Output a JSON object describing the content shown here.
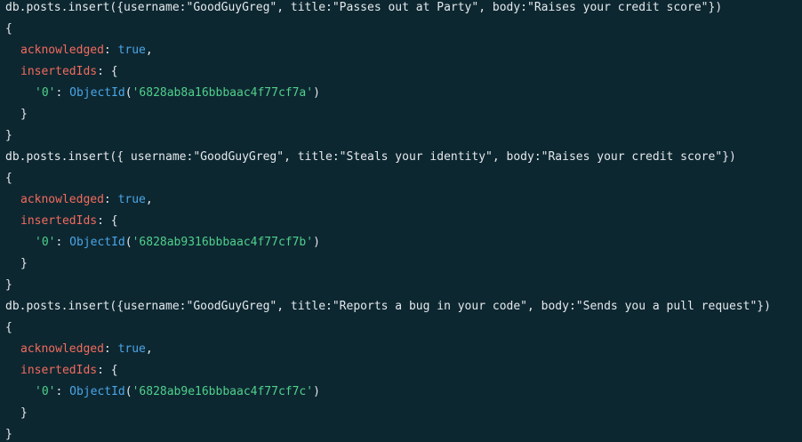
{
  "colors": {
    "background": "#0d2731",
    "foreground": "#e4e9ec",
    "key": "#f36b5c",
    "boolean": "#4aa6e6",
    "string": "#4fd18b",
    "function": "#4aa6e6"
  },
  "blocks": [
    {
      "command": "db.posts.insert({username:\"GoodGuyGreg\", title:\"Passes out at Party\", body:\"Raises your credit score\"})",
      "open_brace": "{",
      "ack_key": "acknowledged",
      "ack_sep": ": ",
      "ack_value": "true",
      "ack_comma": ",",
      "ids_key": "insertedIds",
      "ids_open": ": {",
      "id_index": "'0'",
      "id_sep": ": ",
      "id_fn": "ObjectId",
      "id_paren_open": "(",
      "id_value": "'6828ab8a16bbbaac4f77cf7a'",
      "id_paren_close": ")",
      "ids_close": "}",
      "close_brace": "}"
    },
    {
      "command": "db.posts.insert({ username:\"GoodGuyGreg\", title:\"Steals your identity\", body:\"Raises your credit score\"})",
      "open_brace": "{",
      "ack_key": "acknowledged",
      "ack_sep": ": ",
      "ack_value": "true",
      "ack_comma": ",",
      "ids_key": "insertedIds",
      "ids_open": ": {",
      "id_index": "'0'",
      "id_sep": ": ",
      "id_fn": "ObjectId",
      "id_paren_open": "(",
      "id_value": "'6828ab9316bbbaac4f77cf7b'",
      "id_paren_close": ")",
      "ids_close": "}",
      "close_brace": "}"
    },
    {
      "command": "db.posts.insert({username:\"GoodGuyGreg\", title:\"Reports a bug in your code\", body:\"Sends you a pull request\"})",
      "open_brace": "{",
      "ack_key": "acknowledged",
      "ack_sep": ": ",
      "ack_value": "true",
      "ack_comma": ",",
      "ids_key": "insertedIds",
      "ids_open": ": {",
      "id_index": "'0'",
      "id_sep": ": ",
      "id_fn": "ObjectId",
      "id_paren_open": "(",
      "id_value": "'6828ab9e16bbbaac4f77cf7c'",
      "id_paren_close": ")",
      "ids_close": "}",
      "close_brace": "}"
    }
  ]
}
